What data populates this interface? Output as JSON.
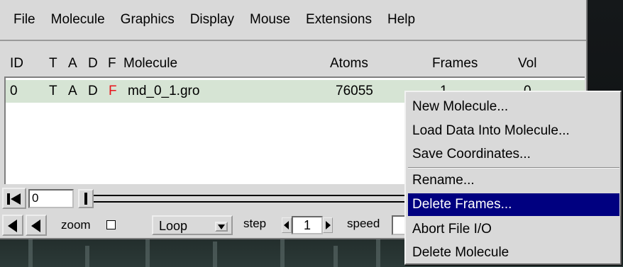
{
  "menubar": {
    "items": [
      "File",
      "Molecule",
      "Graphics",
      "Display",
      "Mouse",
      "Extensions",
      "Help"
    ]
  },
  "mol_list": {
    "headers": {
      "id": "ID",
      "t": "T",
      "a": "A",
      "d": "D",
      "f": "F",
      "molecule": "Molecule",
      "atoms": "Atoms",
      "frames": "Frames",
      "vol": "Vol"
    },
    "rows": [
      {
        "id": "0",
        "t": "T",
        "a": "A",
        "d": "D",
        "f": "F",
        "molecule": "md_0_1.gro",
        "atoms": "76055",
        "frames": "1",
        "vol": "0"
      }
    ]
  },
  "animation": {
    "frame_value": "0",
    "zoom_label": "zoom",
    "zoom_checked": false,
    "loop_mode": "Loop",
    "step_label": "step",
    "step_value": "1",
    "speed_label": "speed"
  },
  "popup_menu": {
    "items": [
      {
        "label": "New Molecule...",
        "active": false
      },
      {
        "label": "Load Data Into Molecule...",
        "active": false
      },
      {
        "label": "Save Coordinates...",
        "active": false
      },
      {
        "label": "Rename...",
        "active": false
      },
      {
        "label": "Delete Frames...",
        "active": true
      },
      {
        "label": "Abort File I/O",
        "active": false
      },
      {
        "label": "Delete Molecule",
        "active": false
      }
    ]
  },
  "colors": {
    "window_bg": "#d9d9d9",
    "row_highlight": "#d6e4d4",
    "menu_active_bg": "#000080",
    "f_flag_red": "#e8131b"
  }
}
